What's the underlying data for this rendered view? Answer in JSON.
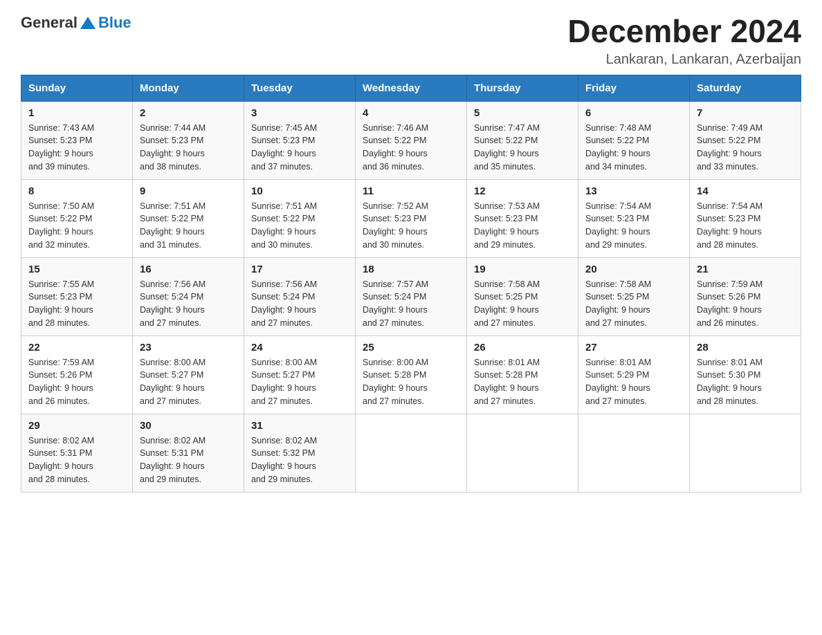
{
  "header": {
    "logo_general": "General",
    "logo_blue": "Blue",
    "month_title": "December 2024",
    "subtitle": "Lankaran, Lankaran, Azerbaijan"
  },
  "days_of_week": [
    "Sunday",
    "Monday",
    "Tuesday",
    "Wednesday",
    "Thursday",
    "Friday",
    "Saturday"
  ],
  "weeks": [
    [
      {
        "day": "1",
        "sunrise": "7:43 AM",
        "sunset": "5:23 PM",
        "daylight": "9 hours and 39 minutes."
      },
      {
        "day": "2",
        "sunrise": "7:44 AM",
        "sunset": "5:23 PM",
        "daylight": "9 hours and 38 minutes."
      },
      {
        "day": "3",
        "sunrise": "7:45 AM",
        "sunset": "5:23 PM",
        "daylight": "9 hours and 37 minutes."
      },
      {
        "day": "4",
        "sunrise": "7:46 AM",
        "sunset": "5:22 PM",
        "daylight": "9 hours and 36 minutes."
      },
      {
        "day": "5",
        "sunrise": "7:47 AM",
        "sunset": "5:22 PM",
        "daylight": "9 hours and 35 minutes."
      },
      {
        "day": "6",
        "sunrise": "7:48 AM",
        "sunset": "5:22 PM",
        "daylight": "9 hours and 34 minutes."
      },
      {
        "day": "7",
        "sunrise": "7:49 AM",
        "sunset": "5:22 PM",
        "daylight": "9 hours and 33 minutes."
      }
    ],
    [
      {
        "day": "8",
        "sunrise": "7:50 AM",
        "sunset": "5:22 PM",
        "daylight": "9 hours and 32 minutes."
      },
      {
        "day": "9",
        "sunrise": "7:51 AM",
        "sunset": "5:22 PM",
        "daylight": "9 hours and 31 minutes."
      },
      {
        "day": "10",
        "sunrise": "7:51 AM",
        "sunset": "5:22 PM",
        "daylight": "9 hours and 30 minutes."
      },
      {
        "day": "11",
        "sunrise": "7:52 AM",
        "sunset": "5:23 PM",
        "daylight": "9 hours and 30 minutes."
      },
      {
        "day": "12",
        "sunrise": "7:53 AM",
        "sunset": "5:23 PM",
        "daylight": "9 hours and 29 minutes."
      },
      {
        "day": "13",
        "sunrise": "7:54 AM",
        "sunset": "5:23 PM",
        "daylight": "9 hours and 29 minutes."
      },
      {
        "day": "14",
        "sunrise": "7:54 AM",
        "sunset": "5:23 PM",
        "daylight": "9 hours and 28 minutes."
      }
    ],
    [
      {
        "day": "15",
        "sunrise": "7:55 AM",
        "sunset": "5:23 PM",
        "daylight": "9 hours and 28 minutes."
      },
      {
        "day": "16",
        "sunrise": "7:56 AM",
        "sunset": "5:24 PM",
        "daylight": "9 hours and 27 minutes."
      },
      {
        "day": "17",
        "sunrise": "7:56 AM",
        "sunset": "5:24 PM",
        "daylight": "9 hours and 27 minutes."
      },
      {
        "day": "18",
        "sunrise": "7:57 AM",
        "sunset": "5:24 PM",
        "daylight": "9 hours and 27 minutes."
      },
      {
        "day": "19",
        "sunrise": "7:58 AM",
        "sunset": "5:25 PM",
        "daylight": "9 hours and 27 minutes."
      },
      {
        "day": "20",
        "sunrise": "7:58 AM",
        "sunset": "5:25 PM",
        "daylight": "9 hours and 27 minutes."
      },
      {
        "day": "21",
        "sunrise": "7:59 AM",
        "sunset": "5:26 PM",
        "daylight": "9 hours and 26 minutes."
      }
    ],
    [
      {
        "day": "22",
        "sunrise": "7:59 AM",
        "sunset": "5:26 PM",
        "daylight": "9 hours and 26 minutes."
      },
      {
        "day": "23",
        "sunrise": "8:00 AM",
        "sunset": "5:27 PM",
        "daylight": "9 hours and 27 minutes."
      },
      {
        "day": "24",
        "sunrise": "8:00 AM",
        "sunset": "5:27 PM",
        "daylight": "9 hours and 27 minutes."
      },
      {
        "day": "25",
        "sunrise": "8:00 AM",
        "sunset": "5:28 PM",
        "daylight": "9 hours and 27 minutes."
      },
      {
        "day": "26",
        "sunrise": "8:01 AM",
        "sunset": "5:28 PM",
        "daylight": "9 hours and 27 minutes."
      },
      {
        "day": "27",
        "sunrise": "8:01 AM",
        "sunset": "5:29 PM",
        "daylight": "9 hours and 27 minutes."
      },
      {
        "day": "28",
        "sunrise": "8:01 AM",
        "sunset": "5:30 PM",
        "daylight": "9 hours and 28 minutes."
      }
    ],
    [
      {
        "day": "29",
        "sunrise": "8:02 AM",
        "sunset": "5:31 PM",
        "daylight": "9 hours and 28 minutes."
      },
      {
        "day": "30",
        "sunrise": "8:02 AM",
        "sunset": "5:31 PM",
        "daylight": "9 hours and 29 minutes."
      },
      {
        "day": "31",
        "sunrise": "8:02 AM",
        "sunset": "5:32 PM",
        "daylight": "9 hours and 29 minutes."
      },
      null,
      null,
      null,
      null
    ]
  ],
  "labels": {
    "sunrise": "Sunrise:",
    "sunset": "Sunset:",
    "daylight": "Daylight:"
  }
}
